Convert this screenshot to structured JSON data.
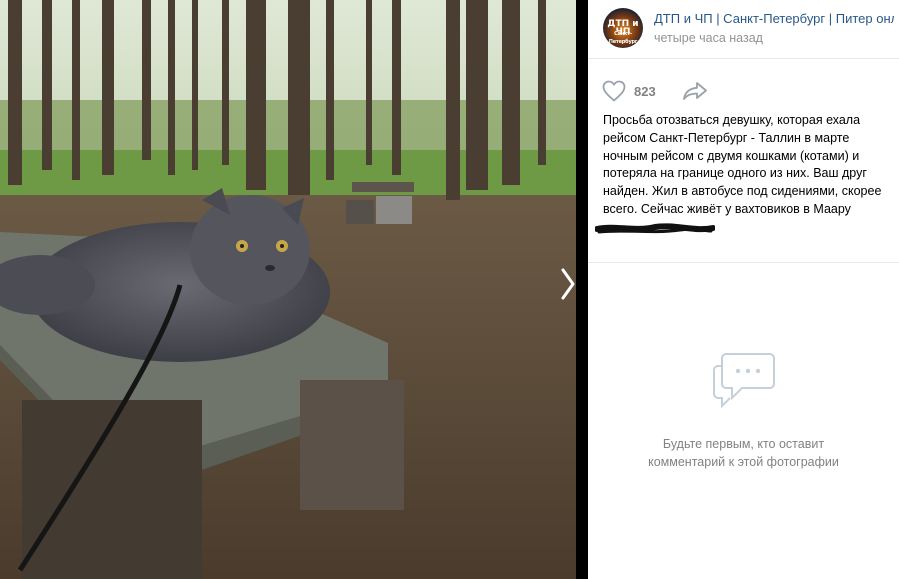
{
  "photo": {
    "description_icon": "photo-viewer"
  },
  "post": {
    "group_name": "ДТП и ЧП | Санкт-Петербург | Питер онлайн",
    "avatar_line1": "ДТП и ЧП",
    "avatar_line2": "Санкт-Петербург",
    "time": "четыре часа назад",
    "likes": "823",
    "text": "Просьба отозваться девушку, которая ехала рейсом Санкт-Петербург - Таллин в марте ночным рейсом с двумя кошками (котами) и потеряла на границе одного из них. Ваш друг найден. Жил в автобусе под сидениями, скорее всего. Сейчас живёт у вахтовиков в Маару"
  },
  "comments": {
    "empty_text": "Будьте первым, кто оставит\nкомментарий к этой фотографии"
  },
  "icons": {
    "like": "heart-icon",
    "share": "share-arrow-icon",
    "comments": "comments-bubble-icon",
    "next": "chevron-right-icon"
  },
  "colors": {
    "link": "#2a5885",
    "muted": "#828282",
    "time": "#939393"
  }
}
